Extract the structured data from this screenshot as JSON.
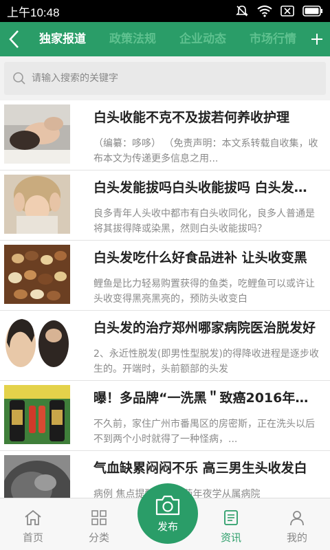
{
  "status_bar": {
    "time": "上午10:48"
  },
  "header": {
    "tabs": [
      {
        "label": "独家报道",
        "active": true
      },
      {
        "label": "政策法规",
        "active": false
      },
      {
        "label": "企业动态",
        "active": false
      },
      {
        "label": "市场行情",
        "active": false
      }
    ]
  },
  "search": {
    "placeholder": "请输入搜索的关键字"
  },
  "articles": [
    {
      "title": "白头收能不克不及拔若何养收护理",
      "summary": "（编纂：哆哆）          （免责声明：本文系转载自收集，收布本文为传递更多信息之用...",
      "thumb": "hair-wash-photo"
    },
    {
      "title": "白头发能拔吗白头收能拔吗 白头发能拔吗",
      "summary": "良多青年人头收中都市有白头收同化，良多人普通是将其拔得降或染黑，然则白头收能拔吗？",
      "thumb": "woman-hair-photo"
    },
    {
      "title": "白头发吃什么好食品进补 让头收变黑",
      "summary": "鲤鱼是比力轻易购置获得的鱼类，吃鲤鱼可以或许让头收变得黑亮黑亮的，预防头收变白",
      "thumb": "nuts-photo"
    },
    {
      "title": "白头发的治疗郑州哪家病院医治脱发好",
      "summary": "2、永近性脱发(即男性型脱发)的得降收进程是逐步收生的。开端时，头前额部的头发",
      "thumb": "balding-head-photo"
    },
    {
      "title": "曝！多品牌“一洗黑＂致癌2016年最新",
      "summary": "不久前，家住广州市番禺区的房密斯，正在洗头以后不到两个小时就得了一种怪病，...",
      "thumb": "product-bottles-photo"
    },
    {
      "title": "气血缺累闷闷不乐 高三男生头收发白",
      "summary": "病例      焦点提醒：中医药年夜学从属病院",
      "thumb": "hair-closeup-photo"
    }
  ],
  "bottom_nav": {
    "items": [
      {
        "label": "首页",
        "icon": "home-icon",
        "active": false
      },
      {
        "label": "分类",
        "icon": "grid-icon",
        "active": false
      },
      {
        "label": "资讯",
        "icon": "news-icon",
        "active": true
      },
      {
        "label": "我的",
        "icon": "user-icon",
        "active": false
      }
    ],
    "publish_label": "发布"
  },
  "colors": {
    "brand": "#2a9d68",
    "inactive_tab": "#5fc18f"
  }
}
